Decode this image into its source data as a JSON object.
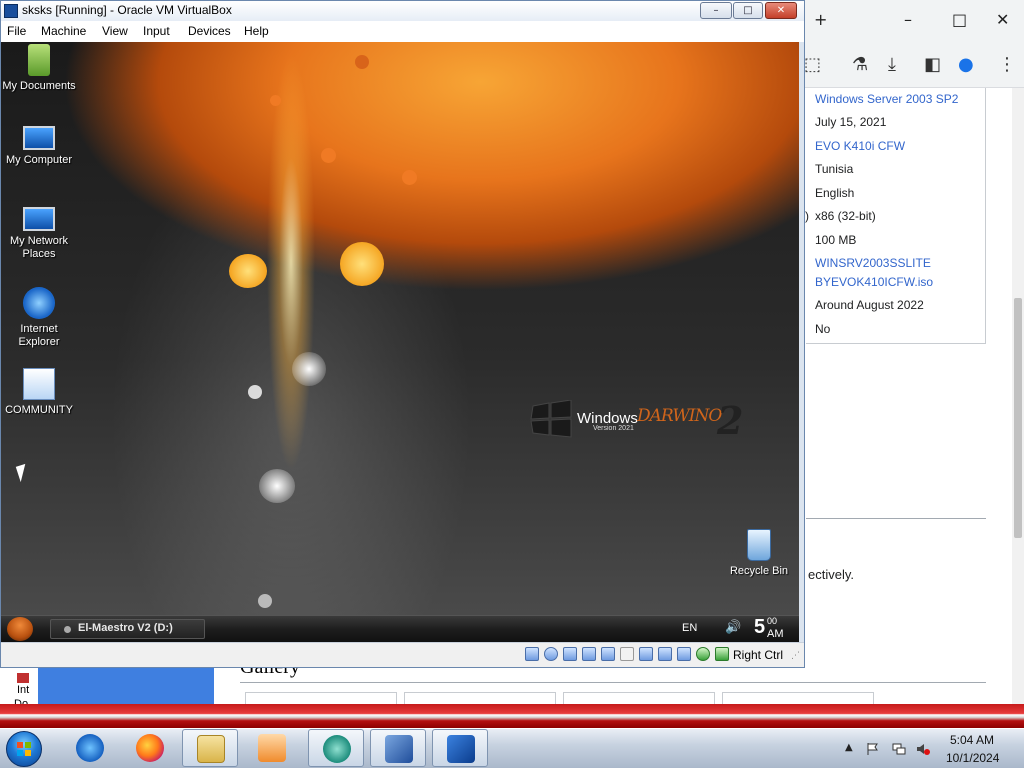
{
  "host_browser": {
    "new_tab_symbol": "+",
    "window_controls": [
      "–",
      "□",
      "✕"
    ],
    "toolbar_icons": [
      "extensions-icon",
      "labs-flask-icon",
      "download-icon",
      "sidebar-icon",
      "profile-icon",
      "more-menu-icon"
    ],
    "info_rows": [
      {
        "text": "Windows Server 2003 SP2",
        "link": true
      },
      {
        "text": "July 15, 2021",
        "link": false
      },
      {
        "text": "EVO K410i CFW",
        "link": true
      },
      {
        "text": "Tunisia",
        "link": false
      },
      {
        "text": "English",
        "link": false
      },
      {
        "text": "x86 (32-bit)",
        "link": false
      },
      {
        "text": "100 MB",
        "link": false
      },
      {
        "text": "WINSRV2003SSLITE",
        "link": true
      },
      {
        "text": "BYEVOK410ICFW.iso",
        "link": true
      },
      {
        "text": "Around August 2022",
        "link": false
      },
      {
        "text": "No",
        "link": false
      }
    ],
    "row_prefix": ")",
    "partial_text": "ectively.",
    "gallery_heading": "Gallery",
    "left_partial_label_1": "Int",
    "left_partial_label_2": "Do"
  },
  "vbox": {
    "title": "sksks [Running] - Oracle VM VirtualBox",
    "window_controls": [
      "–",
      "□",
      "✕"
    ],
    "menu": [
      "File",
      "Machine",
      "View",
      "Input",
      "Devices",
      "Help"
    ],
    "host_key": "Right Ctrl"
  },
  "guest": {
    "desktop_icons": [
      {
        "label": "My Documents",
        "icon": "my-documents-icon"
      },
      {
        "label": "My Computer",
        "icon": "my-computer-icon"
      },
      {
        "label": "My Network Places",
        "icon": "network-places-icon"
      },
      {
        "label": "Internet Explorer",
        "icon": "internet-explorer-icon"
      },
      {
        "label": "COMMUNITY",
        "icon": "community-icon"
      },
      {
        "label": "Recycle Bin",
        "icon": "recycle-bin-icon"
      }
    ],
    "branding": {
      "windows": "Windows",
      "version": "Version 2021",
      "edition": "DARWINO",
      "number": "2"
    },
    "taskbar": {
      "task_label": "El-Maestro V2 (D:)",
      "language": "EN",
      "clock_hour": "5",
      "clock_minutes": "00",
      "clock_ampm": "AM"
    }
  },
  "host_taskbar": {
    "pinned": [
      "internet-explorer-icon",
      "firefox-icon",
      "file-explorer-icon",
      "media-player-icon",
      "teamviewer-icon",
      "virtualbox-icon",
      "xp-vm-icon"
    ],
    "clock_time": "5:04 AM",
    "clock_date": "10/1/2024"
  },
  "colors": {
    "link": "#3366cc",
    "win7_red_band": "#c61b1b",
    "guest_orange": "#e7741c"
  }
}
